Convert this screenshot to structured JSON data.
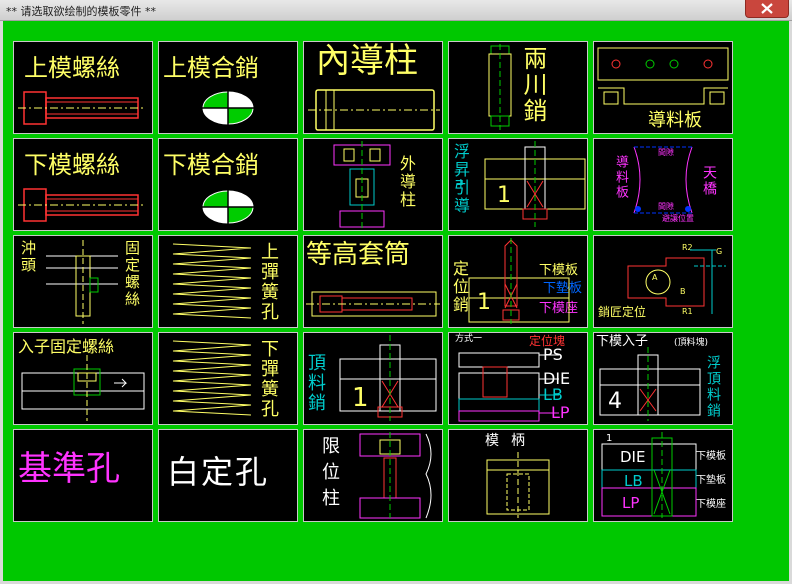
{
  "window": {
    "title": "** 请选取欲绘制的模板零件 **",
    "close_label": "✕"
  },
  "tiles": {
    "t1": {
      "label": "上模螺絲"
    },
    "t2": {
      "label": "上模合銷"
    },
    "t3": {
      "label": "內導柱"
    },
    "t4": {
      "label": "兩川銷"
    },
    "t5": {
      "label": "導料板"
    },
    "t6": {
      "label": "下模螺絲"
    },
    "t7": {
      "label": "下模合銷"
    },
    "t8": {
      "label": "外導柱"
    },
    "t9": {
      "label": "浮昇引導",
      "plus": "+",
      "number": "1"
    },
    "t10": {
      "label_a": "導料板",
      "label_b": "天橋",
      "small1": "間隙",
      "small2": "間隙",
      "small3": "避讓位置"
    },
    "t11": {
      "label_a": "沖頭",
      "label_b": "固定螺絲"
    },
    "t12": {
      "label": "上彈簧孔"
    },
    "t13": {
      "label": "等高套筒"
    },
    "t14": {
      "label_a": "定位銷",
      "label_b": "下模板",
      "label_c": "下墊板",
      "label_d": "下模座",
      "number": "1"
    },
    "t15": {
      "label": "銷匠定位",
      "r2": "R2",
      "r1": "R1",
      "g": "G",
      "a": "A",
      "b": "B"
    },
    "t16": {
      "label": "入子固定螺絲"
    },
    "t17": {
      "label": "下彈簧孔"
    },
    "t18": {
      "label": "頂料銷",
      "number": "1"
    },
    "t19": {
      "head": "方式一",
      "label_pos": "定位塊",
      "ps": "PS",
      "die": "DIE",
      "lb": "LB",
      "lp": "LP"
    },
    "t20": {
      "label_a": "下模入子",
      "label_b": "(頂料塊)",
      "label_c": "浮頂料銷",
      "number": "4"
    },
    "t21": {
      "label": "基準孔"
    },
    "t22": {
      "label": "白定孔"
    },
    "t23": {
      "label": "限位柱"
    },
    "t24": {
      "label": "模柄"
    },
    "t25": {
      "number": "1",
      "die": "DIE",
      "lb": "LB",
      "lp": "LP",
      "r1": "下模板",
      "r2": "下墊板",
      "r3": "下模座"
    }
  }
}
